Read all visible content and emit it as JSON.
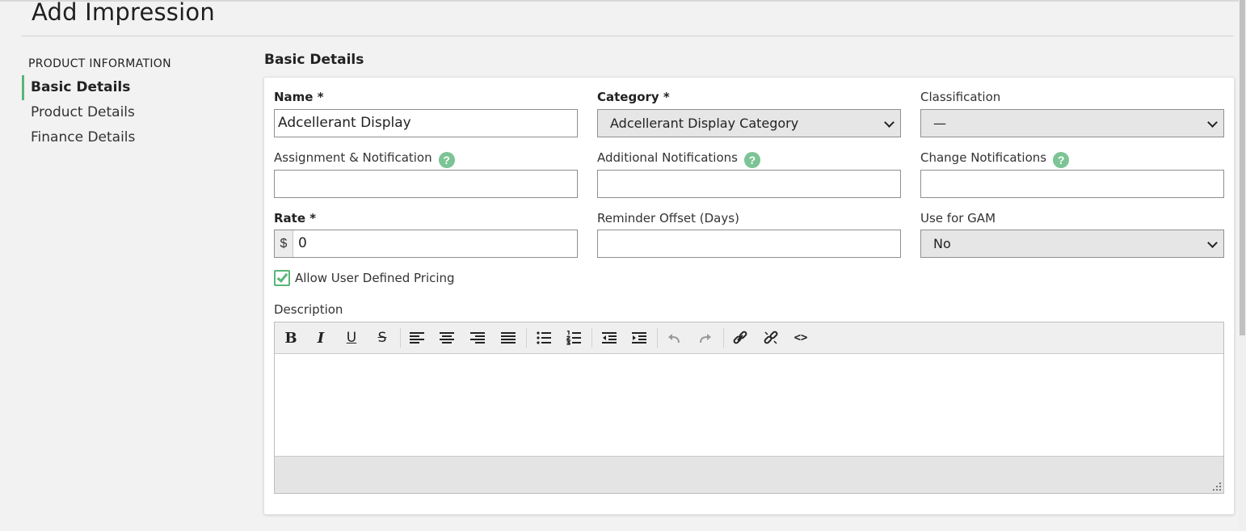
{
  "page": {
    "title": "Add Impression"
  },
  "sidebar": {
    "heading": "PRODUCT INFORMATION",
    "items": [
      {
        "label": "Basic Details",
        "active": true
      },
      {
        "label": "Product Details",
        "active": false
      },
      {
        "label": "Finance Details",
        "active": false
      }
    ]
  },
  "section": {
    "title": "Basic Details"
  },
  "form": {
    "name": {
      "label": "Name *",
      "value": "Adcellerant Display"
    },
    "category": {
      "label": "Category *",
      "value": "Adcellerant Display Category"
    },
    "classification": {
      "label": "Classification",
      "value": "—"
    },
    "assignment": {
      "label": "Assignment & Notification",
      "value": ""
    },
    "additional": {
      "label": "Additional Notifications",
      "value": ""
    },
    "change": {
      "label": "Change Notifications",
      "value": ""
    },
    "rate": {
      "label": "Rate *",
      "prefix": "$",
      "value": "0"
    },
    "reminder": {
      "label": "Reminder Offset (Days)",
      "value": ""
    },
    "gam": {
      "label": "Use for GAM",
      "value": "No"
    },
    "pricing": {
      "label": "Allow User Defined Pricing",
      "checked": true
    },
    "description": {
      "label": "Description",
      "value": ""
    }
  },
  "help_glyph": "?",
  "toolbar": {
    "bold": "B",
    "italic": "I",
    "underline": "U",
    "strike": "S",
    "source": "<>"
  },
  "colors": {
    "accent": "#59b678",
    "help": "#7cc495"
  }
}
